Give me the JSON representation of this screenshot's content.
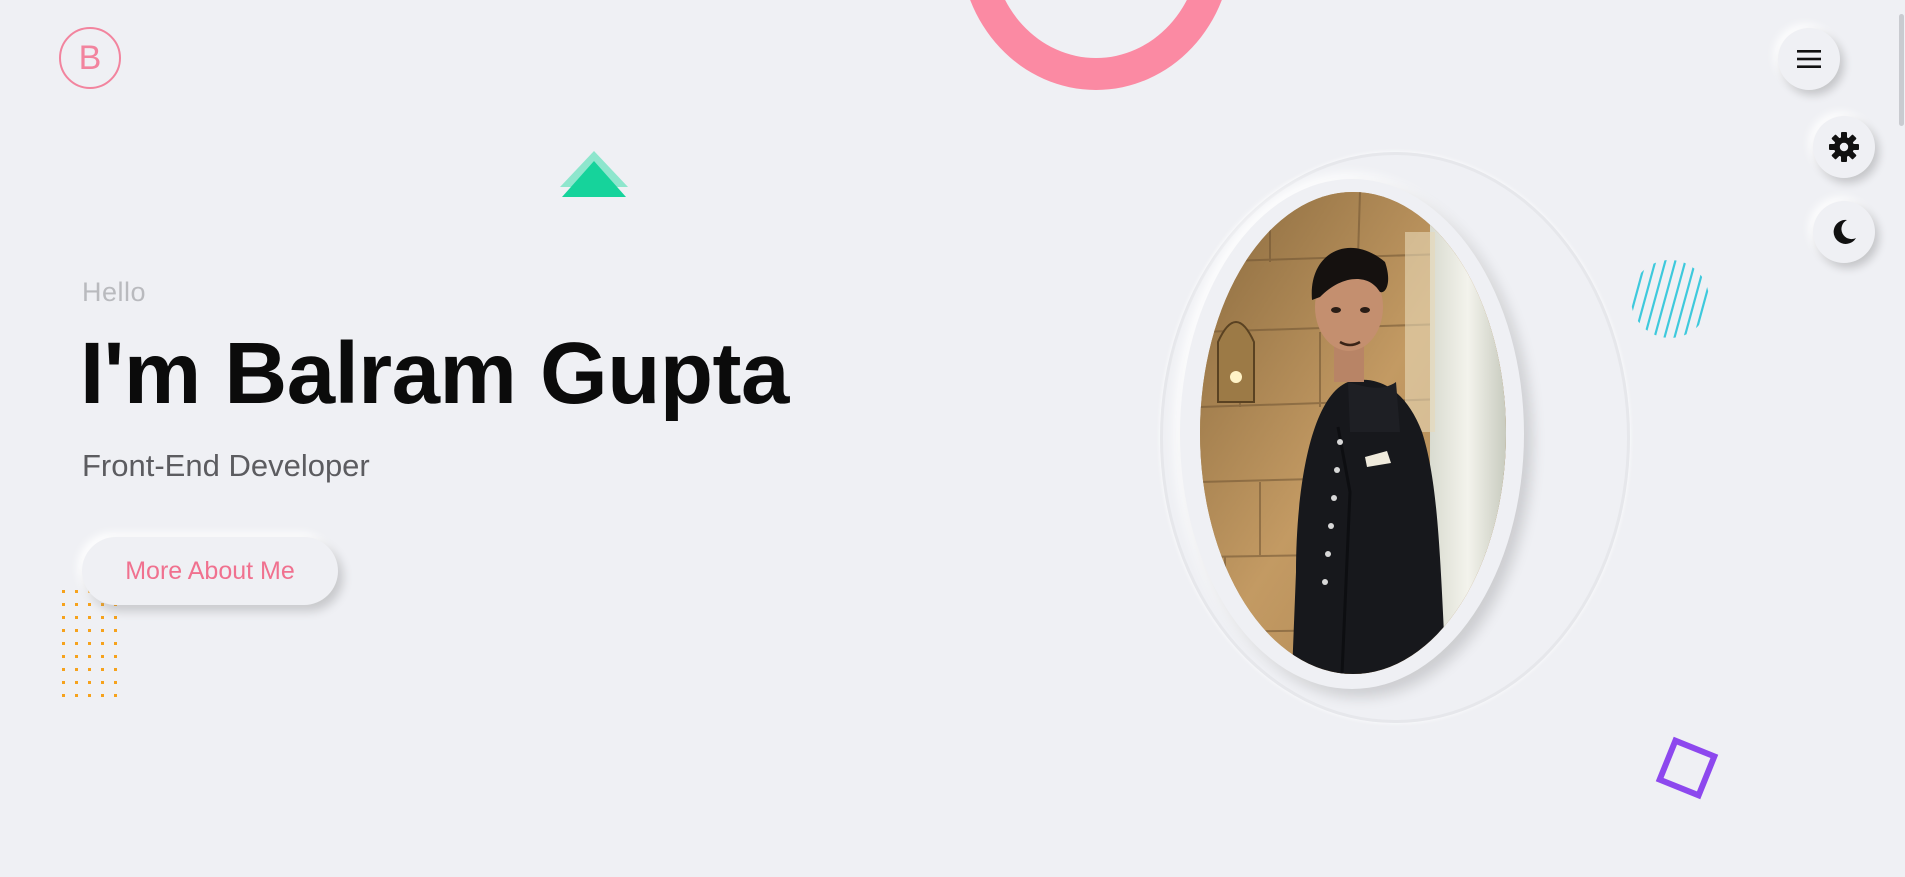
{
  "brand": {
    "logo_letter": "B"
  },
  "hero": {
    "greeting": "Hello",
    "name": "I'm Balram Gupta",
    "role": "Front-End Developer",
    "cta_label": "More About Me"
  },
  "controls": {
    "menu_icon": "hamburger-icon",
    "settings_icon": "gear-icon",
    "theme_icon": "moon-icon"
  },
  "colors": {
    "accent_pink": "#f2849e",
    "ring_pink": "#fb8aa3",
    "triangle_green": "#1dd6a0",
    "stripes_cyan": "#3ec9dc",
    "square_purple": "#8d48ee",
    "dots_orange": "#f6a21b",
    "background": "#eff0f4"
  }
}
